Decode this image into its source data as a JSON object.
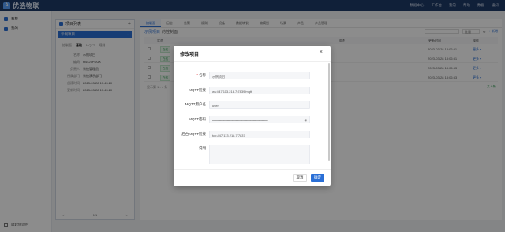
{
  "app": {
    "logo": "A",
    "title": "优选物联"
  },
  "topnav": {
    "items": [
      "数据中心",
      "工作台",
      "我的",
      "帮助",
      "数据",
      "通知"
    ]
  },
  "sidebar": {
    "items": [
      {
        "label": "看板"
      },
      {
        "label": "我的"
      }
    ],
    "bottom": "收起侧边栏"
  },
  "project_list": {
    "title": "项目列表",
    "selected": "示例项目",
    "tabs": [
      "控制面",
      "基础",
      "MQTT",
      "规则"
    ],
    "fields": [
      {
        "k": "名称",
        "v": "示例项目"
      },
      {
        "k": "编码",
        "v": "H4425PDUX"
      },
      {
        "k": "负责人",
        "v": "系统管理员"
      },
      {
        "k": "所属部门",
        "v": "系统演示部门"
      },
      {
        "k": "创建时间",
        "v": "2023-03-28 17:43:20"
      },
      {
        "k": "更新时间",
        "v": "2023-03-28 17:43:20"
      }
    ],
    "pager": {
      "prev": "<",
      "page": "1/1",
      "next": ">"
    }
  },
  "main": {
    "tabs": [
      "控制面",
      "日志",
      "告警",
      "规则",
      "设备",
      "数据转发",
      "物模型",
      "场景",
      "产品",
      "产品管理"
    ],
    "breadcrumb_bold": "示例项目",
    "breadcrumb_rest": "的控制面",
    "select_label": "批量",
    "new_label": "+ 新增",
    "header": {
      "status": "状态",
      "desc": "描述",
      "updated": "更新时间",
      "ops": "操作"
    },
    "rows": [
      {
        "status": "在线",
        "time": "2023-03-28 18:06:51",
        "ops": "更多 ▾"
      },
      {
        "status": "在线",
        "time": "2023-03-28 18:06:51",
        "ops": "更多 ▾"
      },
      {
        "status": "在线",
        "time": "2023-03-28 18:06:53",
        "ops": "更多 ▾"
      },
      {
        "status": "在线",
        "time": "2023-03-28 18:06:53",
        "ops": "更多 ▾"
      }
    ],
    "pager_text": "显示第 1 - 4 条",
    "pager_note": "共 4 条"
  },
  "modal": {
    "title": "修改项目",
    "close": "×",
    "fields": {
      "name": {
        "label": "名称",
        "required": "*",
        "value": "示例项目"
      },
      "mqtt_url": {
        "label": "MQTT链接",
        "value": "ws://47.113.218.7:7839/mqtt"
      },
      "mqtt_user": {
        "label": "MQTT用户名",
        "value": "user"
      },
      "mqtt_pwd": {
        "label": "MQTT密码",
        "value": "••••••••••••••••••••••••••••••••••••••••••••••••••••••••••••••••"
      },
      "backend_mqtt": {
        "label": "后台MQTT链接",
        "value": "tcp://47.113.218.7:7837"
      },
      "desc": {
        "label": "说明",
        "value": ""
      }
    },
    "cancel": "取消",
    "ok": "确定"
  }
}
